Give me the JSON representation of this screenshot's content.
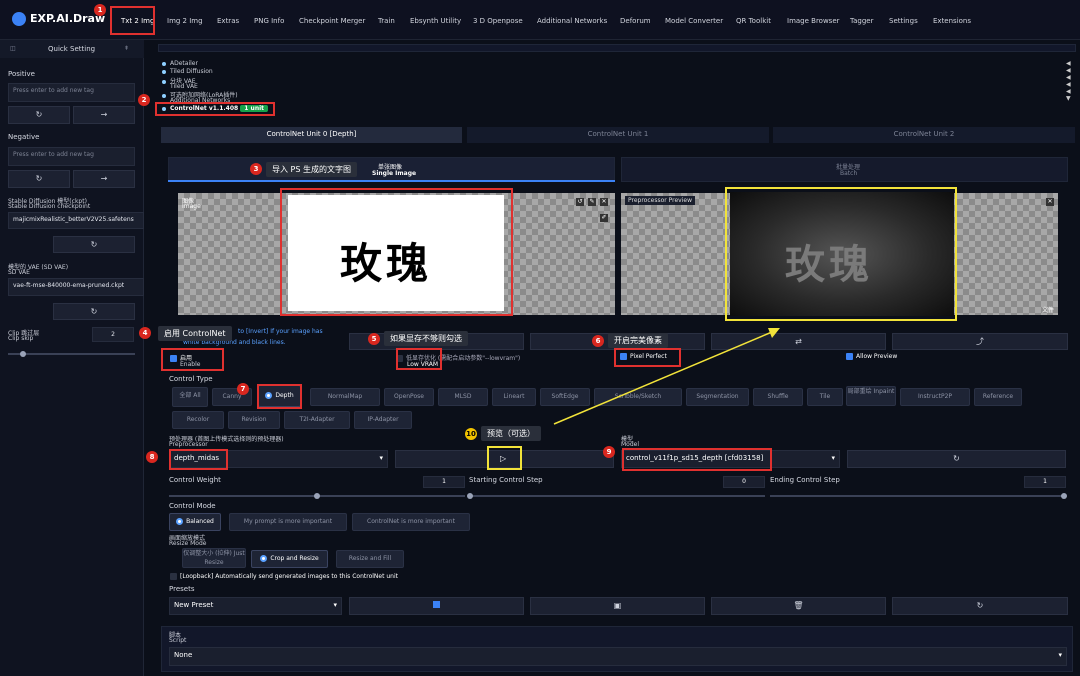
{
  "app": {
    "logo": "EXP.AI.Draw"
  },
  "tabs": [
    "Txt 2 Img",
    "Img 2 Img",
    "Extras",
    "PNG Info",
    "Checkpoint Merger",
    "Train",
    "Ebsynth Utility",
    "3 D Openpose",
    "Additional Networks",
    "Deforum",
    "Model Converter",
    "QR Toolkit",
    "Image Browser",
    "Tagger",
    "Settings",
    "Extensions"
  ],
  "sidebar": {
    "header": "Quick Setting",
    "positive_label": "Positive",
    "positive_placeholder": "Press enter to add new tag",
    "negative_label": "Negative",
    "negative_placeholder": "Press enter to add new tag",
    "refresh_icon": "↻",
    "arrow_icon": "→",
    "checkpoint_label_cn": "Stable Diffusion 模型(ckpt)",
    "checkpoint_label_en": "Stable Diffusion checkpoint",
    "checkpoint_value": "majicmixRealistic_betterV2V25.safetens",
    "vae_label_cn": "模型的 VAE (SD VAE)",
    "vae_label_en": "SD VAE",
    "vae_value": "vae-ft-mse-840000-ema-pruned.ckpt",
    "clip_label_cn": "Clip 跳过层",
    "clip_label_en": "Clip skip",
    "clip_value": "2"
  },
  "accordion": {
    "items": [
      "ADetailer",
      "Tiled Diffusion",
      "分块 VAE",
      "Tiled VAE",
      "可选附加网络(LoRA插件)",
      "Additional Networks"
    ],
    "controlnet_title": "ControlNet v1.1.408",
    "controlnet_badge": "1 unit"
  },
  "units": [
    "ControlNet Unit 0 [Depth]",
    "ControlNet Unit 1",
    "ControlNet Unit 2"
  ],
  "image_tabs": {
    "single_cn": "单张图像",
    "single_en": "Single Image",
    "batch_cn": "批量处理",
    "batch_en": "Batch"
  },
  "input_image": {
    "label_cn": "图像",
    "label_en": "Image",
    "text": "玫瑰"
  },
  "preview": {
    "label": "Preprocessor Preview",
    "text": "玫瑰",
    "corner": "文件"
  },
  "invert_hint": {
    "prefix": "to",
    "link": "[Invert]",
    "rest": "If your image has",
    "line2": "white background and black lines."
  },
  "checks": {
    "enable_cn": "启用",
    "enable_en": "Enable",
    "lowvram_cn": "低显存优化 (需配合启动参数\"--lowvram\")",
    "lowvram_en": "Low VRAM",
    "pixel_perfect": "Pixel Perfect",
    "allow_preview": "Allow Preview"
  },
  "control_type": {
    "label": "Control Type",
    "options": [
      "全部 All",
      "Canny",
      "Depth",
      "NormalMap",
      "OpenPose",
      "MLSD",
      "Lineart",
      "SoftEdge",
      "Scribble/Sketch",
      "Segmentation",
      "Shuffle",
      "Tile",
      "局部重绘 Inpaint",
      "InstructP2P",
      "Reference",
      "Recolor",
      "Revision",
      "T2I-Adapter",
      "IP-Adapter"
    ],
    "selected": "Depth"
  },
  "preprocessor": {
    "label_cn": "预处理器 (首图上传模式选择则的预处理器)",
    "label_en": "Preprocessor",
    "value": "depth_midas",
    "run_icon": "▷"
  },
  "model": {
    "label_cn": "模型",
    "label_en": "Model",
    "value": "control_v11f1p_sd15_depth [cfd03158]"
  },
  "weights": {
    "control_weight_label": "Control Weight",
    "control_weight": "1",
    "start_label": "Starting Control Step",
    "start": "0",
    "end_label": "Ending Control Step",
    "end": "1"
  },
  "control_mode": {
    "label": "Control Mode",
    "options": [
      "Balanced",
      "My prompt is more important",
      "ControlNet is more important"
    ]
  },
  "resize_mode": {
    "label_cn": "画面缩放模式",
    "label_en": "Resize Mode",
    "options": [
      "仅调整大小 (拉伸) Just Resize",
      "Crop and Resize",
      "Resize and Fill"
    ]
  },
  "loopback": "[Loopback] Automatically send generated images to this ControlNet unit",
  "presets": {
    "label": "Presets",
    "value": "New Preset"
  },
  "script": {
    "label_cn": "脚本",
    "label_en": "Script",
    "value": "None"
  },
  "annotations": {
    "b1": "1",
    "b2": "2",
    "b3": "3",
    "b4": "4",
    "b5": "5",
    "b6": "6",
    "b7": "7",
    "b8": "8",
    "b9": "9",
    "b10": "10",
    "a3": "导入 PS 生成的文字图",
    "a4": "启用 ControlNet",
    "a5": "如果显存不够则勾选",
    "a6": "开启完美像素",
    "a10": "预览（可选）"
  }
}
